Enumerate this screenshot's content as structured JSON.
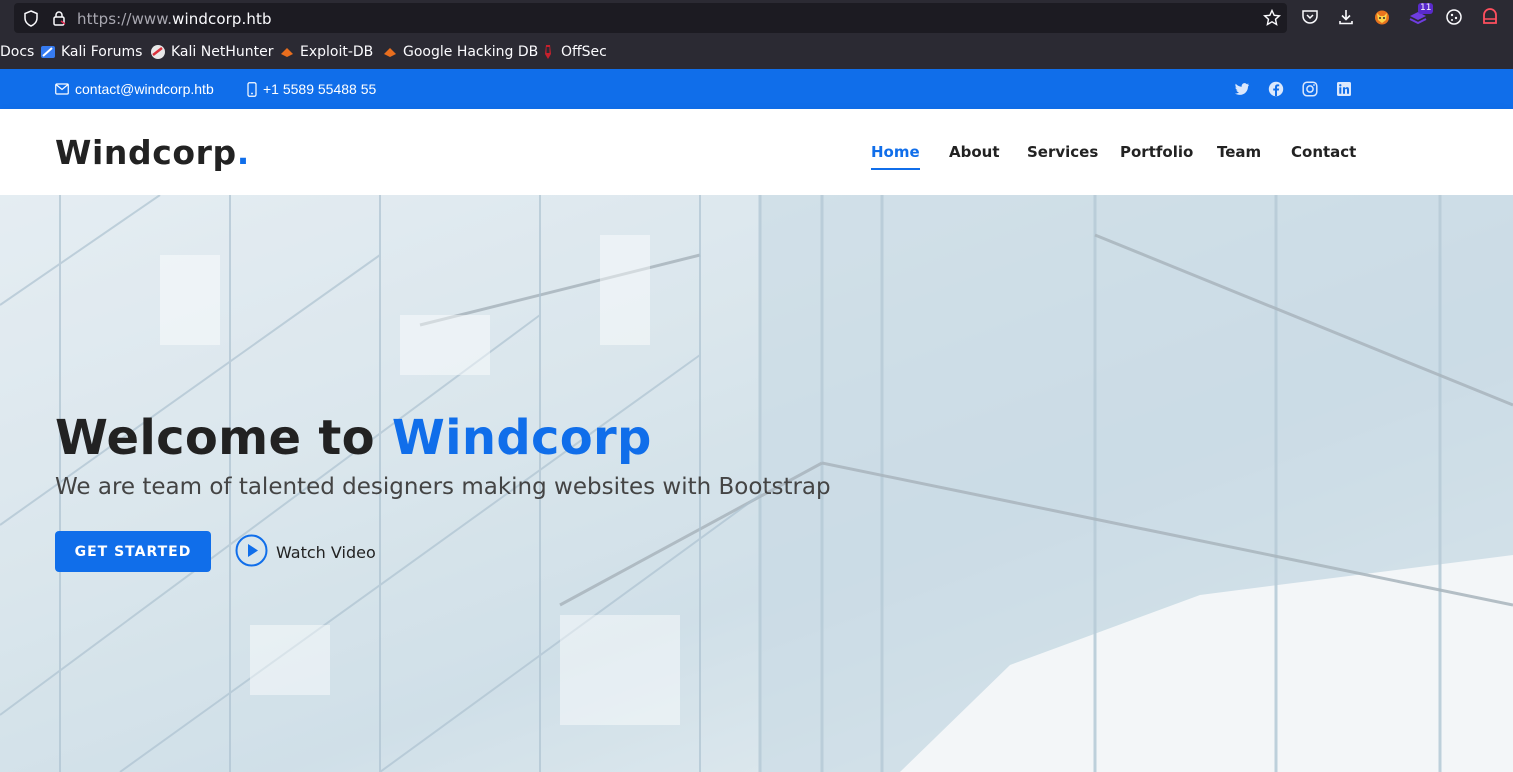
{
  "browser": {
    "url_prefix": "https://www.",
    "url_domain": "windcorp.htb",
    "extension_badge": "11",
    "bookmarks": [
      {
        "label": "Docs",
        "icon": "docs-icon"
      },
      {
        "label": "Kali Forums",
        "icon": "kali-forums-icon"
      },
      {
        "label": "Kali NetHunter",
        "icon": "kali-nethunter-icon"
      },
      {
        "label": "Exploit-DB",
        "icon": "exploit-db-icon"
      },
      {
        "label": "Google Hacking DB",
        "icon": "google-hacking-db-icon"
      },
      {
        "label": "OffSec",
        "icon": "offsec-icon"
      }
    ]
  },
  "topbar": {
    "email": "contact@windcorp.htb",
    "phone": "+1 5589 55488 55",
    "socials": [
      "twitter-icon",
      "facebook-icon",
      "instagram-icon",
      "linkedin-icon"
    ]
  },
  "header": {
    "logo_text": "Windcorp",
    "logo_dot": ".",
    "nav": [
      {
        "label": "Home",
        "active": true
      },
      {
        "label": "About",
        "active": false
      },
      {
        "label": "Services",
        "active": false
      },
      {
        "label": "Portfolio",
        "active": false
      },
      {
        "label": "Team",
        "active": false
      },
      {
        "label": "Contact",
        "active": false
      }
    ]
  },
  "hero": {
    "title_prefix": "Welcome to ",
    "title_accent": "Windcorp",
    "subtitle": "We are team of talented designers making websites with Bootstrap",
    "cta_label": "GET STARTED",
    "video_label": "Watch Video"
  },
  "colors": {
    "brand": "#106eea",
    "chrome_bg": "#2b2a33",
    "dark_text": "#222222"
  }
}
